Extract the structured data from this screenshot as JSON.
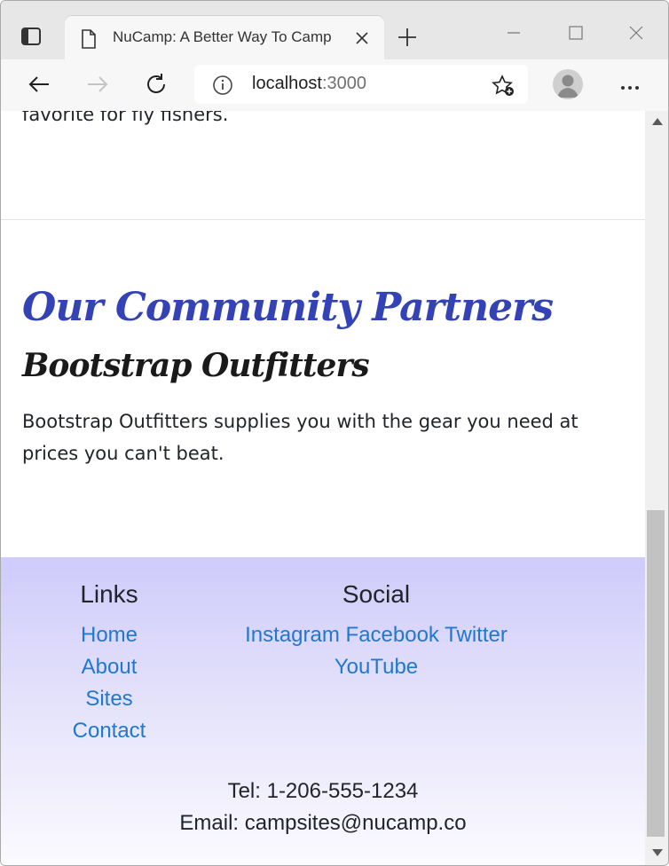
{
  "browser": {
    "tab_title": "NuCamp: A Better Way To Camp",
    "url_host": "localhost",
    "url_port": ":3000"
  },
  "page": {
    "fragment_text": "favorite for fly fishers.",
    "partners_heading": "Our Community Partners",
    "partner": {
      "name": "Bootstrap Outfitters",
      "description": "Bootstrap Outfitters supplies you with the gear you need at prices you can't beat."
    },
    "colors": {
      "heading": "#3343b5",
      "link": "#1f78d1",
      "footer_top": "#cfcbfb",
      "footer_bottom": "#fbfaff"
    }
  },
  "footer": {
    "links_title": "Links",
    "links": [
      {
        "label": "Home"
      },
      {
        "label": "About"
      },
      {
        "label": "Sites"
      },
      {
        "label": "Contact"
      }
    ],
    "social_title": "Social",
    "social": [
      {
        "label": "Instagram"
      },
      {
        "label": "Facebook"
      },
      {
        "label": "Twitter"
      },
      {
        "label": "YouTube"
      }
    ],
    "tel": "Tel: 1-206-555-1234",
    "email": "Email: campsites@nucamp.co"
  }
}
